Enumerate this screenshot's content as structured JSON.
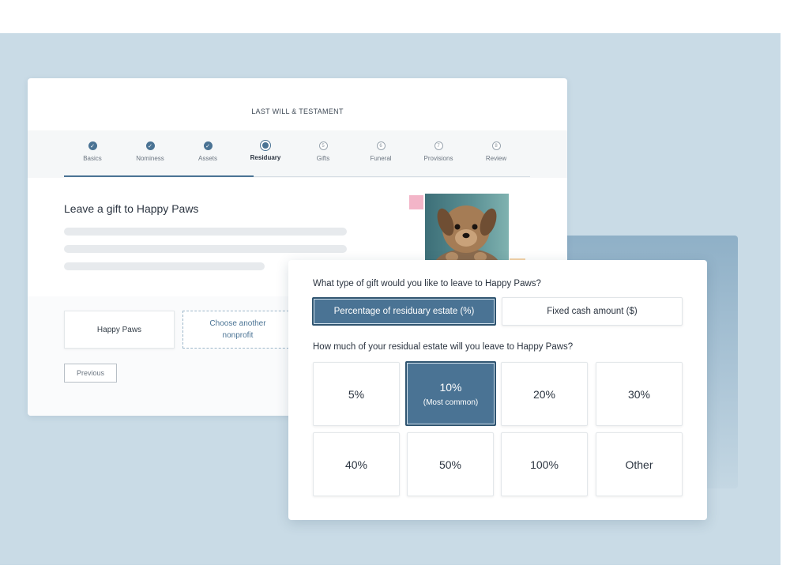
{
  "document": {
    "title": "LAST WILL & TESTAMENT"
  },
  "steps": [
    {
      "label": "Basics",
      "status": "done",
      "glyph": "✓"
    },
    {
      "label": "Nominess",
      "status": "done",
      "glyph": "✓"
    },
    {
      "label": "Assets",
      "status": "done",
      "glyph": "✓"
    },
    {
      "label": "Residuary",
      "status": "current",
      "glyph": ""
    },
    {
      "label": "Gifts",
      "status": "todo",
      "glyph": "5"
    },
    {
      "label": "Funeral",
      "status": "todo",
      "glyph": "6"
    },
    {
      "label": "Provisions",
      "status": "todo",
      "glyph": "7"
    },
    {
      "label": "Review",
      "status": "todo",
      "glyph": "8"
    }
  ],
  "gift": {
    "heading": "Leave a gift to Happy Paws"
  },
  "nonprofits": {
    "selected": "Happy Paws",
    "other": "Choose another nonprofit"
  },
  "nav": {
    "previous": "Previous"
  },
  "gift_type": {
    "question": "What type of gift would you like to leave to Happy Paws?",
    "options": [
      "Percentage of residuary estate (%)",
      "Fixed cash amount ($)"
    ],
    "selected_index": 0
  },
  "residual": {
    "question": "How much of your residual estate will you leave to Happy Paws?",
    "options": [
      {
        "label": "5%",
        "sub": ""
      },
      {
        "label": "10%",
        "sub": "(Most common)"
      },
      {
        "label": "20%",
        "sub": ""
      },
      {
        "label": "30%",
        "sub": ""
      },
      {
        "label": "40%",
        "sub": ""
      },
      {
        "label": "50%",
        "sub": ""
      },
      {
        "label": "100%",
        "sub": ""
      },
      {
        "label": "Other",
        "sub": ""
      }
    ],
    "selected_index": 1
  },
  "colors": {
    "accent": "#4a7394",
    "background": "#c9dbe6"
  }
}
